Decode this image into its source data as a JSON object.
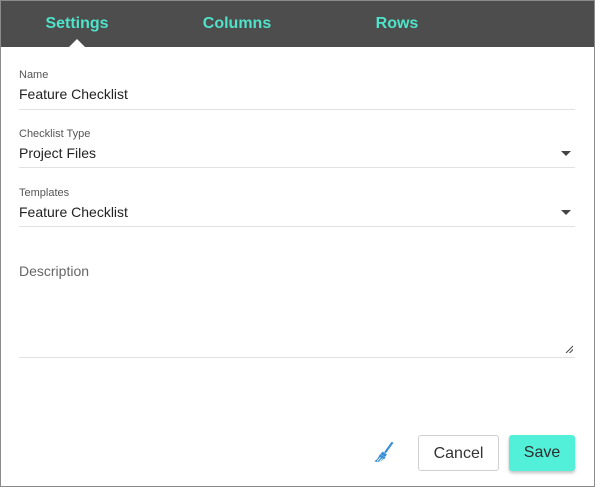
{
  "tabs": [
    {
      "label": "Settings",
      "active": true
    },
    {
      "label": "Columns",
      "active": false
    },
    {
      "label": "Rows",
      "active": false
    }
  ],
  "form": {
    "name": {
      "label": "Name",
      "value": "Feature Checklist"
    },
    "checklist_type": {
      "label": "Checklist Type",
      "value": "Project Files"
    },
    "templates": {
      "label": "Templates",
      "value": "Feature Checklist"
    },
    "description": {
      "placeholder": "Description",
      "value": ""
    }
  },
  "actions": {
    "clear_icon": "broom-icon",
    "cancel_label": "Cancel",
    "save_label": "Save"
  },
  "colors": {
    "tab_bar": "#4d4d4d",
    "tab_text": "#4fe3c9",
    "save_button": "#52f0d8",
    "broom_icon": "#3a8fd6"
  }
}
